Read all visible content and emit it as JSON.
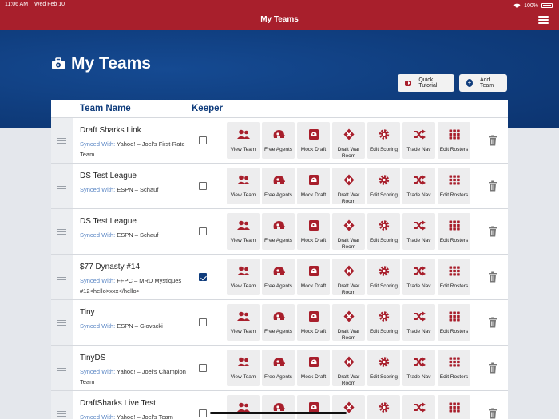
{
  "status_bar": {
    "time": "11:06 AM",
    "date": "Wed Feb 10",
    "battery": "100%"
  },
  "nav": {
    "title": "My Teams"
  },
  "header": {
    "title": "My Teams",
    "quick_tutorial": "Quick Tutorial",
    "add_team": "Add Team"
  },
  "table": {
    "col_team": "Team Name",
    "col_keeper": "Keeper",
    "synced_prefix": "Synced With:",
    "actions": [
      "View Team",
      "Free Agents",
      "Mock Draft",
      "Draft War Room",
      "Edit Scoring",
      "Trade Nav",
      "Edit Rosters"
    ],
    "rows": [
      {
        "name": "Draft Sharks Link",
        "sync": "Yahoo! – Joel's First-Rate Team",
        "keeper": false
      },
      {
        "name": "DS Test League",
        "sync": "ESPN – Schauf",
        "keeper": false
      },
      {
        "name": "DS Test League",
        "sync": "ESPN – Schauf",
        "keeper": false
      },
      {
        "name": "$77 Dynasty #14",
        "sync": "FFPC – MRD Mystiques #12<hello>xxx</hello>",
        "keeper": true
      },
      {
        "name": "Tiny",
        "sync": "ESPN – Glovacki",
        "keeper": false
      },
      {
        "name": "TinyDS",
        "sync": "Yahoo! – Joel's Champion Team",
        "keeper": false
      },
      {
        "name": "DraftSharks Live Test",
        "sync": "Yahoo! – Joel's Team",
        "keeper": false
      }
    ]
  },
  "colors": {
    "brand_red": "#a81f2c",
    "brand_blue": "#0f3c7c",
    "sync_label": "#5a86c4"
  }
}
